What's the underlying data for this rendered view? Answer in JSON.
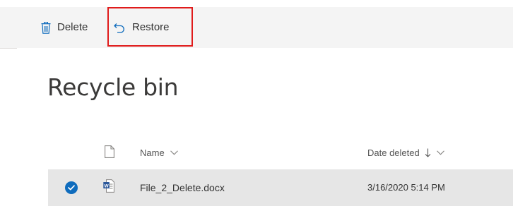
{
  "toolbar": {
    "delete_label": "Delete",
    "restore_label": "Restore",
    "delete_icon": "trash-icon",
    "restore_icon": "undo-arrow-icon",
    "highlight_color": "#e01b1b"
  },
  "page": {
    "title": "Recycle bin"
  },
  "table": {
    "columns": [
      {
        "key": "type",
        "label": "",
        "icon": "document-icon"
      },
      {
        "key": "name",
        "label": "Name",
        "icon": "chevron-down-icon"
      },
      {
        "key": "date_deleted",
        "label": "Date deleted",
        "sort": "descending",
        "icon": "chevron-down-icon"
      }
    ],
    "rows": [
      {
        "selected": true,
        "type_icon": "word-document-icon",
        "name": "File_2_Delete.docx",
        "date_deleted": "3/16/2020 5:14 PM"
      }
    ]
  },
  "colors": {
    "accent": "#0f6cbd",
    "command_bar_bg": "#f4f4f4",
    "selected_row_bg": "#e6e6e6",
    "word_blue": "#2b579a"
  }
}
